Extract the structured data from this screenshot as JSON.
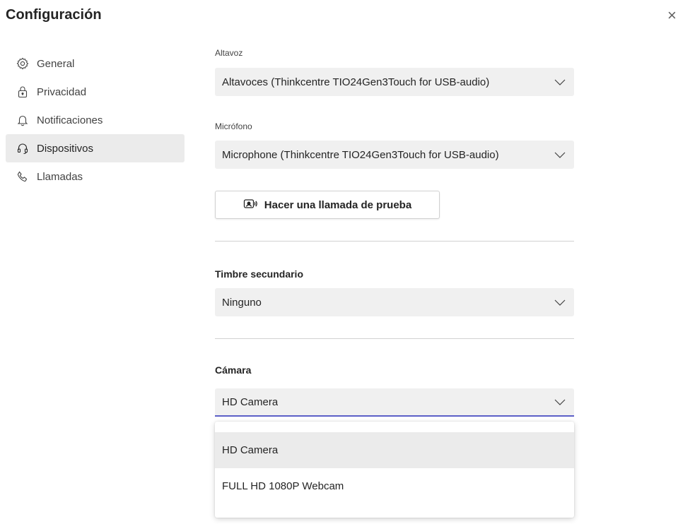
{
  "header": {
    "title": "Configuración",
    "close_glyph": "×"
  },
  "sidebar": {
    "items": [
      {
        "label": "General",
        "icon": "gear-icon"
      },
      {
        "label": "Privacidad",
        "icon": "lock-icon"
      },
      {
        "label": "Notificaciones",
        "icon": "bell-icon"
      },
      {
        "label": "Dispositivos",
        "icon": "headset-icon",
        "active": true
      },
      {
        "label": "Llamadas",
        "icon": "phone-icon"
      }
    ]
  },
  "devices": {
    "speaker": {
      "label": "Altavoz",
      "value": "Altavoces (Thinkcentre TIO24Gen3Touch for USB-audio)"
    },
    "microphone": {
      "label": "Micrófono",
      "value": "Microphone (Thinkcentre TIO24Gen3Touch for USB-audio)"
    },
    "test_call": {
      "label": "Hacer una llamada de prueba",
      "icon": "test-call-icon"
    },
    "secondary_ringer": {
      "title": "Timbre secundario",
      "value": "Ninguno"
    },
    "camera": {
      "title": "Cámara",
      "value": "HD Camera",
      "options": [
        "HD Camera",
        "FULL HD 1080P Webcam"
      ],
      "highlighted_option": "HD Camera"
    }
  },
  "colors": {
    "accent": "#5b5fc7",
    "selected_bg": "#ebebeb",
    "select_bg": "#f0f0f0"
  }
}
